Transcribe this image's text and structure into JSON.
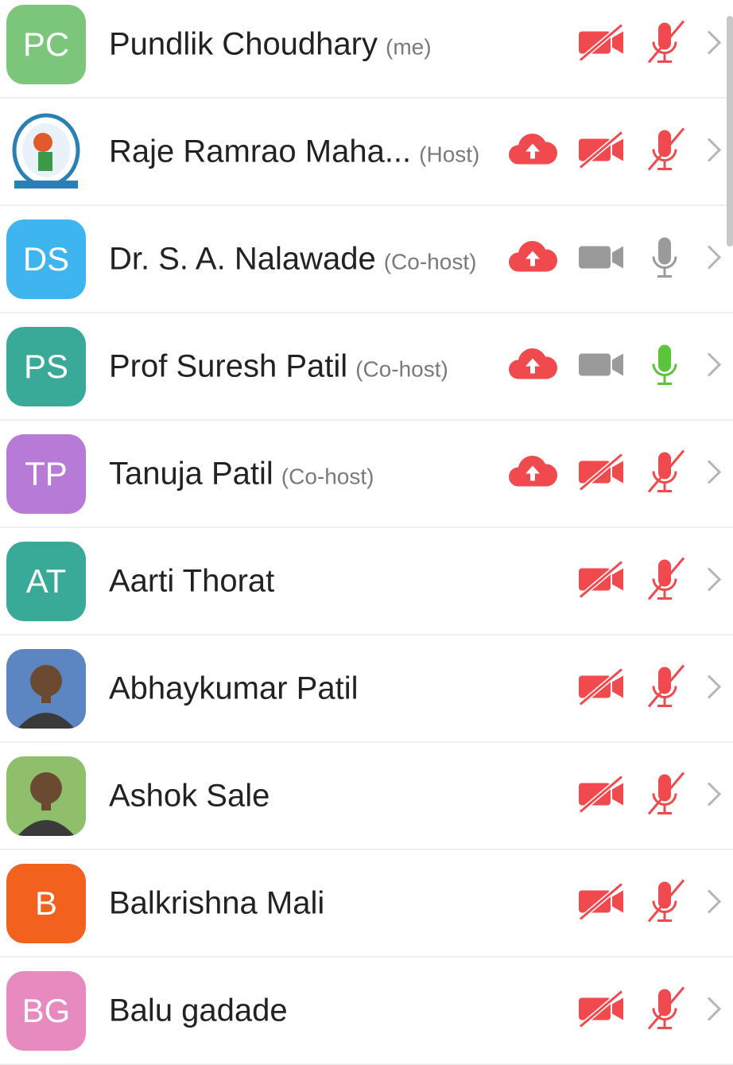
{
  "colors": {
    "muted_red": "#f04a4f",
    "muted_grey": "#9a9a9a",
    "speaking_green": "#5cc43a",
    "cloud_red": "#f04a4f"
  },
  "participants": [
    {
      "initials": "PC",
      "avatar_color": "#7bc67b",
      "avatar_type": "initials",
      "name": "Pundlik Choudhary",
      "role": "(me)",
      "recording": false,
      "video": "off",
      "mic": "muted"
    },
    {
      "initials": "",
      "avatar_color": "#ffffff",
      "avatar_type": "emblem-image",
      "name": "Raje Ramrao Maha...",
      "role": "(Host)",
      "recording": true,
      "video": "off",
      "mic": "muted"
    },
    {
      "initials": "DS",
      "avatar_color": "#3fb5f0",
      "avatar_type": "initials",
      "name": "Dr. S. A. Nalawade",
      "role": "(Co-host)",
      "recording": true,
      "video": "inactive",
      "mic": "inactive"
    },
    {
      "initials": "PS",
      "avatar_color": "#3aaa98",
      "avatar_type": "initials",
      "name": "Prof Suresh Patil",
      "role": "(Co-host)",
      "recording": true,
      "video": "inactive",
      "mic": "speaking"
    },
    {
      "initials": "TP",
      "avatar_color": "#b77ad6",
      "avatar_type": "initials",
      "name": "Tanuja Patil",
      "role": "(Co-host)",
      "recording": true,
      "video": "off",
      "mic": "muted"
    },
    {
      "initials": "AT",
      "avatar_color": "#3aaa98",
      "avatar_type": "initials",
      "name": "Aarti Thorat",
      "role": "",
      "recording": false,
      "video": "off",
      "mic": "muted"
    },
    {
      "initials": "",
      "avatar_color": "#5b86c2",
      "avatar_type": "photo",
      "name": "Abhaykumar Patil",
      "role": "",
      "recording": false,
      "video": "off",
      "mic": "muted"
    },
    {
      "initials": "",
      "avatar_color": "#8fbf6a",
      "avatar_type": "photo",
      "name": "Ashok Sale",
      "role": "",
      "recording": false,
      "video": "off",
      "mic": "muted"
    },
    {
      "initials": "B",
      "avatar_color": "#f2611d",
      "avatar_type": "initials",
      "name": "Balkrishna Mali",
      "role": "",
      "recording": false,
      "video": "off",
      "mic": "muted"
    },
    {
      "initials": "BG",
      "avatar_color": "#e68ac0",
      "avatar_type": "initials",
      "name": "Balu gadade",
      "role": "",
      "recording": false,
      "video": "off",
      "mic": "muted"
    }
  ]
}
